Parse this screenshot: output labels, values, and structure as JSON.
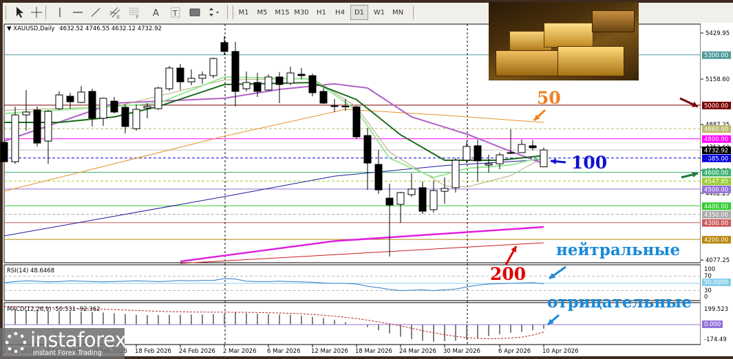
{
  "toolbar": {
    "tools": [
      "cursor-icon",
      "crosshair-icon",
      "vertical-line-icon",
      "horizontal-line-icon",
      "trendline-icon",
      "equidistant-channel-icon",
      "fibonacci-icon",
      "text-icon",
      "text-label-icon",
      "rectangle-icon",
      "arrows-dropdown-icon"
    ],
    "timeframes": [
      "M1",
      "M5",
      "M15",
      "M30",
      "H1",
      "H4",
      "D1",
      "W1",
      "MN"
    ],
    "active_timeframe": "D1"
  },
  "chart_header": {
    "symbol": "XAUUSD,Daily",
    "ohlc": "4632.52 4746.55 4632.12 4732.92"
  },
  "price_axis": {
    "ticks": [
      "5429.95",
      "5158.60",
      "4887.25",
      "4753.60",
      "4618.90",
      "4482.25",
      "4077.25"
    ],
    "levels": [
      {
        "value": 5300,
        "label": "5300.00",
        "color": "#4f9a9a",
        "style": "solid"
      },
      {
        "value": 5000,
        "label": "5000.00",
        "color": "#7b0000",
        "style": "solid"
      },
      {
        "value": 4860,
        "label": "4860.00",
        "color": "#bdb76b",
        "style": "dashed"
      },
      {
        "value": 4800,
        "label": "4800.00",
        "color": "#ff00ff",
        "style": "solid"
      },
      {
        "value": 4732.92,
        "label": "4732.92",
        "color": "#000000",
        "style": "solid-gray"
      },
      {
        "value": 4685,
        "label": "4685.00",
        "color": "#0000e0",
        "style": "dashed"
      },
      {
        "value": 4600,
        "label": "4600.00",
        "color": "#3cb371",
        "style": "solid"
      },
      {
        "value": 4547.85,
        "label": "4547.85",
        "color": "#9acd32",
        "style": "dashed"
      },
      {
        "value": 4500,
        "label": "4500.00",
        "color": "#9370db",
        "style": "solid"
      },
      {
        "value": 4400,
        "label": "4400.00",
        "color": "#32cd32",
        "style": "solid"
      },
      {
        "value": 4350,
        "label": "4350.00",
        "color": "#a9a9a9",
        "style": "dashed"
      },
      {
        "value": 4300,
        "label": "4300.00",
        "color": "#cd5c5c",
        "style": "solid"
      },
      {
        "value": 4200,
        "label": "4200.00",
        "color": "#b8860b",
        "style": "solid"
      }
    ]
  },
  "date_axis": [
    "2 Feb 2026",
    "6 Feb 2026",
    "12 Feb 2026",
    "18 Feb 2026",
    "24 Feb 2026",
    "2 Mar 2026",
    "6 Mar 2026",
    "12 Mar 2026",
    "18 Mar 2026",
    "24 Mar 2026",
    "30 Mar 2026",
    "6 Apr 2026",
    "10 Apr 2026"
  ],
  "annotations": {
    "ma50": "50",
    "ma100": "100",
    "ma200": "200",
    "rsi_note": "нейтральные",
    "macd_note": "отрицательные"
  },
  "rsi": {
    "title": "RSI(14) 48.6468",
    "ticks": [
      "100",
      "70",
      "50.0000",
      "30",
      "0"
    ]
  },
  "macd": {
    "title": "MACD(12,26,9) -50.531 -92.362",
    "ticks": [
      "199.523",
      "0.000",
      "-174.49"
    ]
  },
  "logo": {
    "name": "instaforex",
    "tagline": "Instant Forex Trading"
  },
  "chart_data": {
    "type": "candlestick",
    "symbol": "XAUUSD",
    "timeframe": "Daily",
    "ylim": [
      4077.25,
      5429.95
    ],
    "candles_ohlc": [
      [
        4778,
        4889,
        4660,
        4663
      ],
      [
        4663,
        4992,
        4651,
        4942
      ],
      [
        4942,
        5090,
        4848,
        4959
      ],
      [
        4971,
        4992,
        4754,
        4774
      ],
      [
        4786,
        4971,
        4651,
        4963
      ],
      [
        4979,
        5082,
        4971,
        5061
      ],
      [
        5053,
        5073,
        4979,
        5020
      ],
      [
        5016,
        5114,
        5012,
        5078
      ],
      [
        5082,
        5098,
        4873,
        4922
      ],
      [
        4922,
        5045,
        4877,
        5041
      ],
      [
        5024,
        5049,
        4950,
        4959
      ],
      [
        4987,
        5004,
        4832,
        4873
      ],
      [
        4860,
        5004,
        4848,
        4975
      ],
      [
        4983,
        5012,
        4922,
        4992
      ],
      [
        4979,
        5110,
        4971,
        5102
      ],
      [
        5098,
        5233,
        5086,
        5221
      ],
      [
        5221,
        5246,
        5090,
        5139
      ],
      [
        5139,
        5213,
        5119,
        5160
      ],
      [
        5160,
        5201,
        5127,
        5180
      ],
      [
        5176,
        5283,
        5160,
        5278
      ],
      [
        5373,
        5410,
        5299,
        5320
      ],
      [
        5320,
        5377,
        4992,
        5082
      ],
      [
        5098,
        5201,
        5082,
        5135
      ],
      [
        5135,
        5192,
        5049,
        5082
      ],
      [
        5090,
        5184,
        5086,
        5168
      ],
      [
        5168,
        5197,
        5012,
        5123
      ],
      [
        5131,
        5229,
        5119,
        5192
      ],
      [
        5184,
        5221,
        5155,
        5176
      ],
      [
        5176,
        5188,
        5053,
        5074
      ],
      [
        5082,
        5102,
        5008,
        5012
      ],
      [
        4994,
        5037,
        4959,
        4996
      ],
      [
        4994,
        5037,
        4967,
        4990
      ],
      [
        4990,
        4994,
        4799,
        4811
      ],
      [
        4819,
        4864,
        4495,
        4655
      ],
      [
        4647,
        4733,
        4471,
        4495
      ],
      [
        4446,
        4532,
        4098,
        4405
      ],
      [
        4409,
        4483,
        4299,
        4479
      ],
      [
        4467,
        4594,
        4454,
        4500
      ],
      [
        4508,
        4545,
        4352,
        4368
      ],
      [
        4377,
        4549,
        4360,
        4491
      ],
      [
        4487,
        4569,
        4413,
        4504
      ],
      [
        4508,
        4684,
        4479,
        4672
      ],
      [
        4672,
        4786,
        4655,
        4754
      ],
      [
        4758,
        4795,
        4545,
        4668
      ],
      [
        4643,
        4705,
        4598,
        4651
      ],
      [
        4651,
        4717,
        4618,
        4704
      ],
      [
        4713,
        4856,
        4709,
        4717
      ],
      [
        4717,
        4795,
        4717,
        4766
      ],
      [
        4758,
        4791,
        4729,
        4746
      ],
      [
        4632.52,
        4746.55,
        4632.12,
        4732.92
      ]
    ],
    "moving_averages": [
      {
        "name": "MA200",
        "color": "#c81e1e",
        "width": 1,
        "points": [
          [
            16,
            4057
          ],
          [
            49,
            4180
          ]
        ]
      },
      {
        "name": "MA200-alt",
        "color": "#e020e0",
        "width": 2.5,
        "points": [
          [
            16,
            4069
          ],
          [
            30,
            4190
          ],
          [
            49,
            4274
          ]
        ]
      },
      {
        "name": "MA100",
        "color": "#1a1a9a",
        "width": 1,
        "points": [
          [
            0,
            4221
          ],
          [
            20,
            4455
          ],
          [
            30,
            4577
          ],
          [
            40,
            4640
          ],
          [
            49,
            4676
          ]
        ]
      },
      {
        "name": "MA50",
        "color": "#e8902a",
        "width": 1,
        "points": [
          [
            0,
            4487
          ],
          [
            20,
            4815
          ],
          [
            31,
            4975
          ],
          [
            40,
            4940
          ],
          [
            49,
            4897
          ]
        ]
      },
      {
        "name": "MA-violet",
        "color": "#b060c8",
        "width": 2,
        "points": [
          [
            0,
            4786
          ],
          [
            10,
            5012
          ],
          [
            20,
            5041
          ],
          [
            25,
            5094
          ],
          [
            30,
            5127
          ],
          [
            33,
            5102
          ],
          [
            37,
            4930
          ],
          [
            42,
            4828
          ],
          [
            46,
            4725
          ],
          [
            49,
            4651
          ]
        ]
      },
      {
        "name": "MA-tan",
        "color": "#b8a878",
        "width": 1,
        "points": [
          [
            0,
            4970
          ],
          [
            10,
            4990
          ],
          [
            20,
            5150
          ],
          [
            28,
            5160
          ],
          [
            32,
            4990
          ],
          [
            35,
            4720
          ],
          [
            40,
            4520
          ],
          [
            42,
            4512
          ],
          [
            46,
            4580
          ],
          [
            49,
            4690
          ]
        ]
      },
      {
        "name": "MA-lightgreen",
        "color": "#98e898",
        "width": 2,
        "points": [
          [
            0,
            4950
          ],
          [
            5,
            4971
          ],
          [
            10,
            4992
          ],
          [
            14,
            5012
          ],
          [
            20,
            5168
          ],
          [
            28,
            5155
          ],
          [
            32,
            4971
          ],
          [
            35,
            4684
          ],
          [
            39,
            4569
          ],
          [
            42,
            4623
          ],
          [
            46,
            4643
          ],
          [
            49,
            4692
          ]
        ]
      },
      {
        "name": "MA-darkgreen",
        "color": "#1a6a1a",
        "width": 2,
        "points": [
          [
            0,
            4897
          ],
          [
            5,
            4897
          ],
          [
            10,
            4930
          ],
          [
            14,
            4992
          ],
          [
            20,
            5123
          ],
          [
            28,
            5135
          ],
          [
            32,
            5033
          ],
          [
            36,
            4823
          ],
          [
            40,
            4672
          ],
          [
            45,
            4672
          ],
          [
            49,
            4700
          ]
        ]
      }
    ],
    "rsi_values": [
      52,
      55,
      57,
      56,
      54,
      55,
      57,
      56,
      55,
      54,
      55,
      56,
      57,
      56,
      55,
      56,
      58,
      57,
      58,
      58,
      63,
      62,
      56,
      55,
      55,
      56,
      55,
      54,
      53,
      51,
      50,
      50,
      48,
      42,
      38,
      33,
      30,
      31,
      32,
      30,
      32,
      34,
      40,
      45,
      48,
      49,
      50,
      51,
      52,
      48.6
    ],
    "macd_histogram": [
      190,
      185,
      180,
      175,
      172,
      168,
      165,
      160,
      155,
      150,
      140,
      130,
      120,
      118,
      118,
      120,
      122,
      125,
      125,
      130,
      135,
      150,
      140,
      135,
      130,
      125,
      120,
      110,
      95,
      80,
      60,
      30,
      5,
      -30,
      -70,
      -110,
      -150,
      -180,
      -200,
      -210,
      -205,
      -200,
      -185,
      -165,
      -140,
      -120,
      -100,
      -90,
      -70,
      -50.5
    ],
    "macd_signal": [
      225,
      222,
      218,
      214,
      210,
      206,
      202,
      198,
      194,
      190,
      185,
      180,
      175,
      170,
      165,
      160,
      158,
      156,
      155,
      154,
      154,
      153,
      152,
      150,
      147,
      144,
      140,
      134,
      126,
      116,
      104,
      90,
      74,
      55,
      33,
      10,
      -15,
      -45,
      -75,
      -100,
      -125,
      -145,
      -160,
      -170,
      -175,
      -172,
      -165,
      -155,
      -130,
      -92.4
    ]
  }
}
